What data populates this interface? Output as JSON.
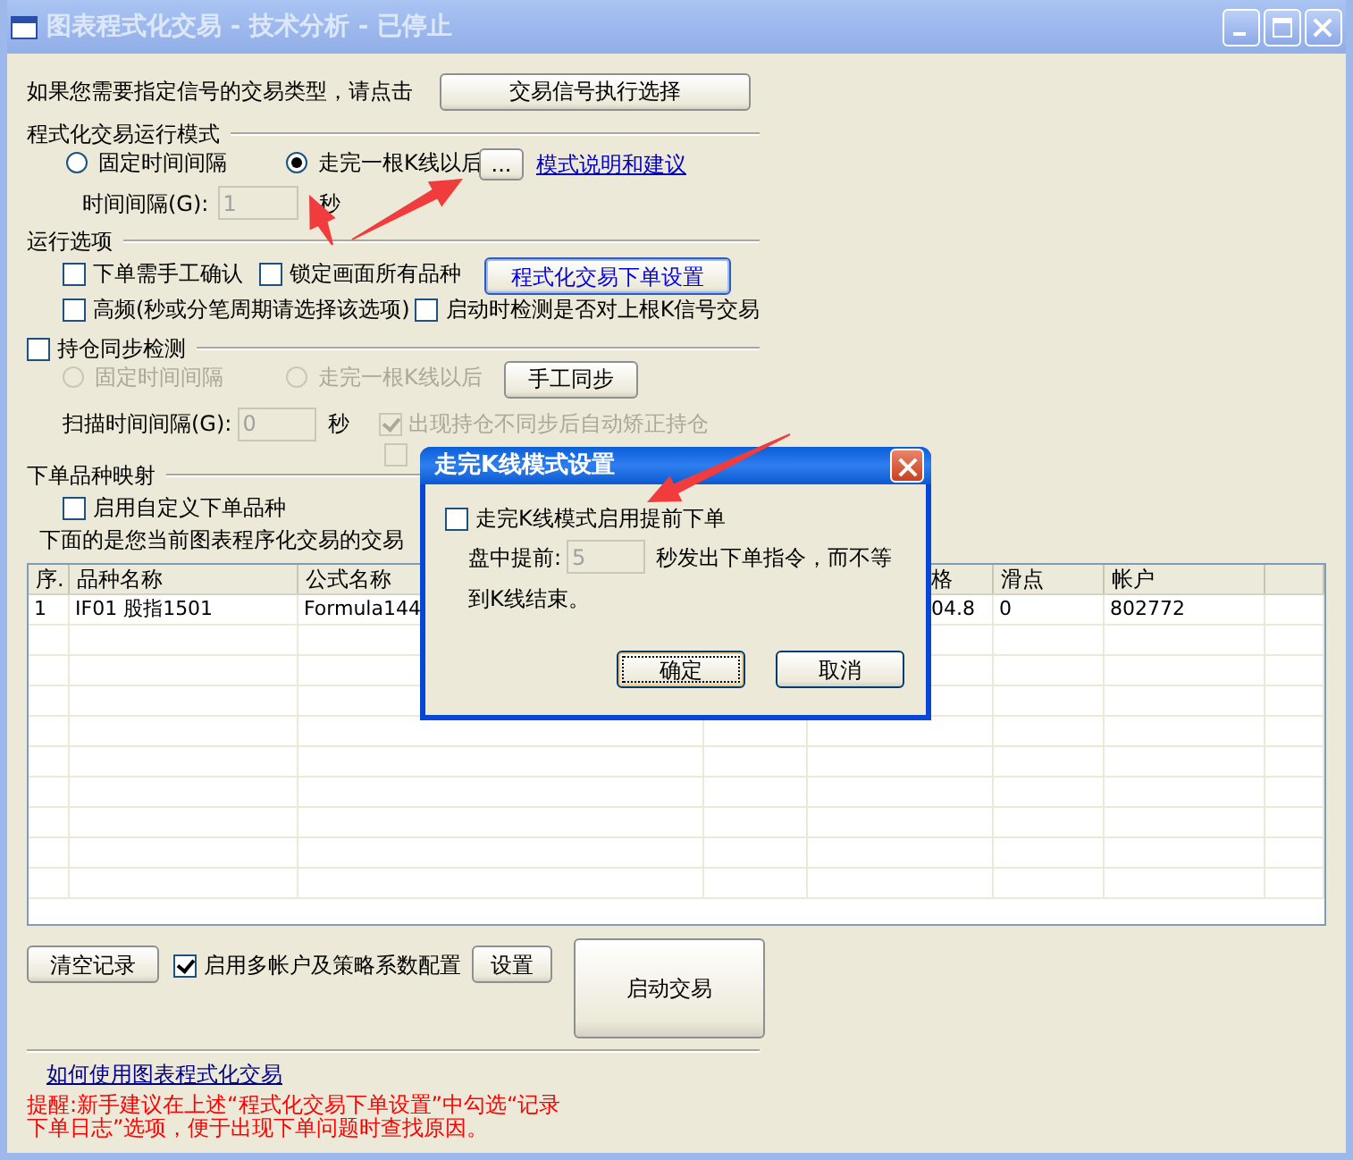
{
  "window": {
    "title": "图表程式化交易 - 技术分析 - 已停止",
    "active": false
  },
  "signal_row": {
    "label": "如果您需要指定信号的交易类型，请点击",
    "button": "交易信号执行选择"
  },
  "run_mode": {
    "title": "程式化交易运行模式",
    "options": [
      {
        "label": "固定时间间隔",
        "selected": false
      },
      {
        "label": "走完一根K线以后",
        "selected": true
      }
    ],
    "more_button": "...",
    "help_link": "模式说明和建议",
    "interval_label": "时间间隔(G):",
    "interval_value": "1",
    "interval_unit": "秒",
    "interval_disabled": true
  },
  "run_options": {
    "title": "运行选项",
    "checkboxes": [
      {
        "label": "下单需手工确认",
        "checked": false
      },
      {
        "label": "锁定画面所有品种",
        "checked": false
      },
      {
        "label": "高频(秒或分笔周期请选择该选项)",
        "checked": false
      },
      {
        "label": "启动时检测是否对上根K信号交易",
        "checked": false
      }
    ],
    "order_settings_button": "程式化交易下单设置"
  },
  "position_sync": {
    "label": "持仓同步检测",
    "checked": false,
    "options": [
      {
        "label": "固定时间间隔",
        "selected": false,
        "disabled": true
      },
      {
        "label": "走完一根K线以后",
        "selected": false,
        "disabled": true
      }
    ],
    "sync_button": "手工同步",
    "scan_label": "扫描时间间隔(G):",
    "scan_value": "0",
    "scan_unit": "秒",
    "checkboxes": [
      {
        "label": "出现持仓不同步后自动矫正持仓",
        "checked": true,
        "disabled": true
      },
      {
        "checked": false,
        "disabled": true
      }
    ]
  },
  "symbol_mapping": {
    "title": "下单品种映射",
    "checkbox": {
      "label": "启用自定义下单品种",
      "checked": false
    },
    "note": "下面的是您当前图表程序化交易的交易"
  },
  "table": {
    "columns": [
      "序.",
      "品种名称",
      "公式名称",
      "格",
      "滑点",
      "帐户"
    ],
    "rows": [
      [
        "1",
        "IF01 股指1501",
        "Formula144",
        "04.8",
        "0",
        "802772"
      ]
    ]
  },
  "bottom": {
    "clear_button": "清空记录",
    "multi_account": {
      "label": "启用多帐户及策略系数配置",
      "checked": true
    },
    "settings_button": "设置",
    "start_button": "启动交易",
    "help_link": "如何使用图表程式化交易",
    "tip_lines": [
      "提醒:新手建议在上述“程式化交易下单设置”中勾选“记录",
      "下单日志”选项，便于出现下单问题时查找原因。"
    ]
  },
  "dialog": {
    "title": "走完K线模式设置",
    "checkbox": {
      "label": "走完K线模式启用提前下单",
      "checked": false
    },
    "advance_label": "盘中提前:",
    "advance_value": "5",
    "advance_suffix": "秒发出下单指令，而不等",
    "advance_suffix_2": "到K线结束。",
    "buttons": [
      {
        "label": "确定",
        "focused": true
      },
      {
        "label": "取消",
        "focused": false
      }
    ]
  }
}
